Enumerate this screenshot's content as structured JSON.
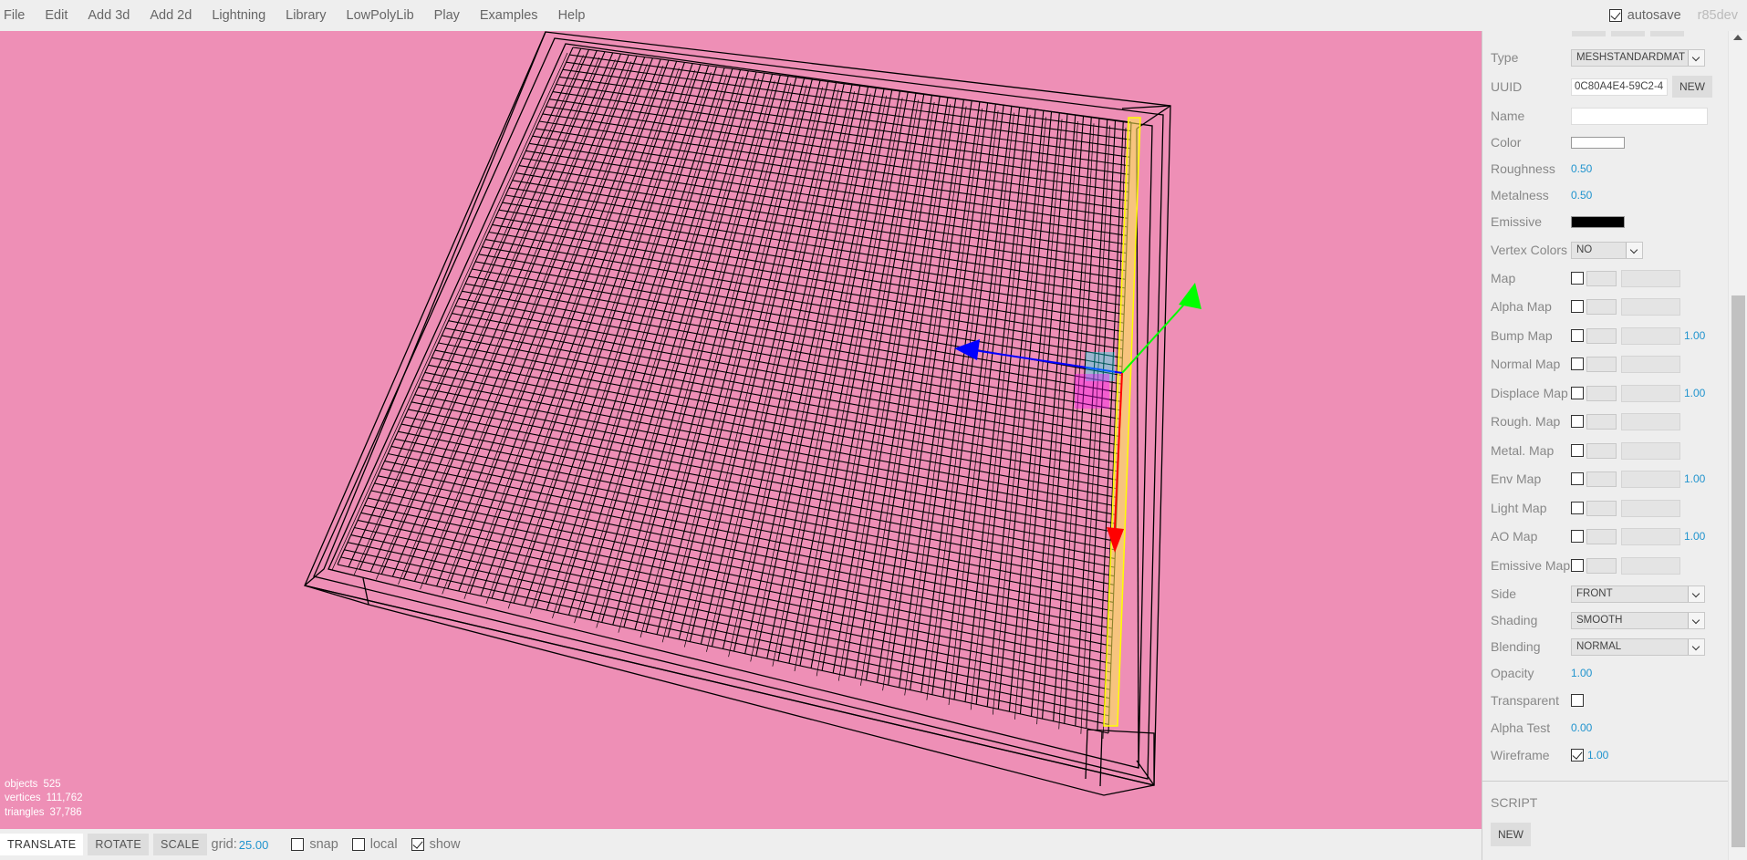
{
  "menubar": {
    "items": [
      "File",
      "Edit",
      "Add 3d",
      "Add 2d",
      "Lightning",
      "Library",
      "LowPolyLib",
      "Play",
      "Examples",
      "Help"
    ],
    "autosave_label": "autosave",
    "autosave_checked": true,
    "version": "r85dev"
  },
  "info": {
    "objects_label": "objects",
    "objects": "525",
    "vertices_label": "vertices",
    "vertices": "111,762",
    "triangles_label": "triangles",
    "triangles": "37,786"
  },
  "toolbar": {
    "translate": "TRANSLATE",
    "rotate": "ROTATE",
    "scale": "SCALE",
    "grid_label": "grid:",
    "grid_value": "25.00",
    "snap_label": "snap",
    "local_label": "local",
    "show_label": "show",
    "snap_checked": false,
    "local_checked": false,
    "show_checked": true
  },
  "material": {
    "type_label": "Type",
    "type_value": "MESHSTANDARDMAT",
    "uuid_label": "UUID",
    "uuid_value": "0C80A4E4-59C2-4",
    "uuid_new": "NEW",
    "name_label": "Name",
    "name_value": "",
    "color_label": "Color",
    "color_value": "#ffffff",
    "roughness_label": "Roughness",
    "roughness_value": "0.50",
    "metalness_label": "Metalness",
    "metalness_value": "0.50",
    "emissive_label": "Emissive",
    "emissive_value": "#000000",
    "vertex_colors_label": "Vertex Colors",
    "vertex_colors_value": "NO",
    "maps": [
      {
        "label": "Map",
        "value": ""
      },
      {
        "label": "Alpha Map",
        "value": ""
      },
      {
        "label": "Bump Map",
        "value": "1.00"
      },
      {
        "label": "Normal Map",
        "value": ""
      },
      {
        "label": "Displace Map",
        "value": "1.00"
      },
      {
        "label": "Rough. Map",
        "value": ""
      },
      {
        "label": "Metal. Map",
        "value": ""
      },
      {
        "label": "Env Map",
        "value": "1.00"
      },
      {
        "label": "Light Map",
        "value": ""
      },
      {
        "label": "AO Map",
        "value": "1.00"
      },
      {
        "label": "Emissive Map",
        "value": ""
      }
    ],
    "side_label": "Side",
    "side_value": "FRONT",
    "shading_label": "Shading",
    "shading_value": "SMOOTH",
    "blending_label": "Blending",
    "blending_value": "NORMAL",
    "opacity_label": "Opacity",
    "opacity_value": "1.00",
    "transparent_label": "Transparent",
    "transparent_checked": false,
    "alpha_test_label": "Alpha Test",
    "alpha_test_value": "0.00",
    "wireframe_label": "Wireframe",
    "wireframe_checked": true,
    "wireframe_value": "1.00"
  },
  "script": {
    "label": "SCRIPT",
    "new_button": "NEW"
  },
  "colors": {
    "viewport_bg": "#ee8fb6",
    "accent_number": "#2194ce",
    "gizmo_x": "#ff0000",
    "gizmo_y": "#00ff00",
    "gizmo_z": "#0000ff",
    "selection": "#ffff00"
  }
}
